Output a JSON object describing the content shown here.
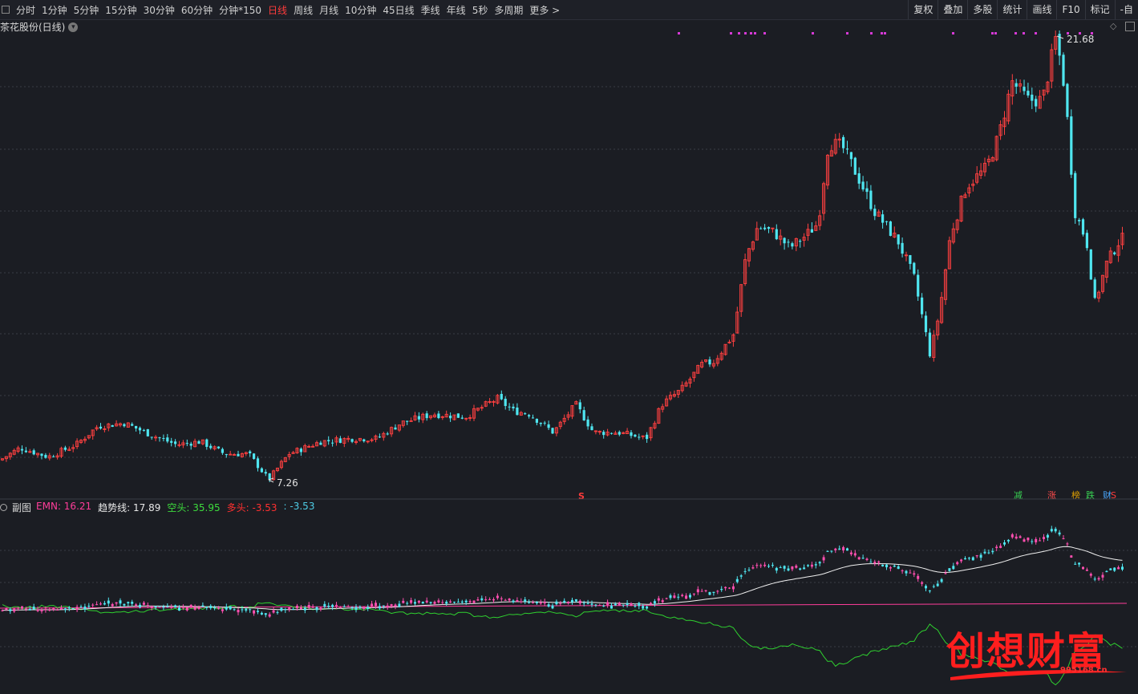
{
  "toolbar": {
    "periods": [
      "分时",
      "1分钟",
      "5分钟",
      "15分钟",
      "30分钟",
      "60分钟",
      "分钟*150",
      "日线",
      "周线",
      "月线",
      "10分钟",
      "45日线",
      "季线",
      "年线",
      "5秒",
      "多周期",
      "更多 >"
    ],
    "active_period": "日线",
    "right_tools": [
      "复权",
      "叠加",
      "多股",
      "统计",
      "画线",
      "F10",
      "标记",
      "-自"
    ]
  },
  "chart": {
    "title": "茶花股份(日线)",
    "high_label": "21.68",
    "low_label": "7.26",
    "signal_labels": [
      {
        "text": "减",
        "color": "#39d353"
      },
      {
        "text": "涨",
        "color": "#ff4b4b"
      },
      {
        "text": "榜",
        "color": "#e0a000"
      },
      {
        "text": "跌",
        "color": "#39d353"
      },
      {
        "text": "财",
        "color": "#4aa8ff"
      },
      {
        "text": "S",
        "color": "#ff3b3b"
      }
    ],
    "s_marker": "S"
  },
  "sub": {
    "name": "副图",
    "items": [
      {
        "label": "EMN",
        "value": "16.21",
        "label_color": "#ff3d9a",
        "value_color": "#ff3d9a"
      },
      {
        "label": "趋势线",
        "value": "17.89",
        "label_color": "#e8e8e8",
        "value_color": "#e8e8e8"
      },
      {
        "label": "空头",
        "value": "35.95",
        "label_color": "#3ddc3d",
        "value_color": "#3ddc3d"
      },
      {
        "label": "多头",
        "value": "-3.53",
        "label_color": "#ff3030",
        "value_color": "#ff3030"
      },
      {
        "label": "",
        "value": "-3.53",
        "label_color": "#4ecde6",
        "value_color": "#4ecde6"
      }
    ]
  },
  "watermark": {
    "text": "创想财富",
    "url": "995168.cn"
  },
  "chart_data": {
    "type": "candlestick",
    "y_max": 21.68,
    "y_min": 7.26,
    "control_points": [
      [
        0,
        7.9
      ],
      [
        25,
        8.3
      ],
      [
        60,
        8.0
      ],
      [
        95,
        8.4
      ],
      [
        122,
        9.0
      ],
      [
        155,
        9.1
      ],
      [
        190,
        8.7
      ],
      [
        220,
        8.4
      ],
      [
        250,
        8.5
      ],
      [
        280,
        8.1
      ],
      [
        310,
        8.1
      ],
      [
        335,
        7.26
      ],
      [
        360,
        8.1
      ],
      [
        400,
        8.5
      ],
      [
        440,
        8.6
      ],
      [
        470,
        8.6
      ],
      [
        500,
        9.1
      ],
      [
        540,
        9.4
      ],
      [
        580,
        9.3
      ],
      [
        620,
        9.9
      ],
      [
        640,
        9.5
      ],
      [
        660,
        9.4
      ],
      [
        690,
        8.8
      ],
      [
        718,
        9.7
      ],
      [
        740,
        8.8
      ],
      [
        770,
        8.8
      ],
      [
        806,
        8.6
      ],
      [
        825,
        9.7
      ],
      [
        850,
        10.2
      ],
      [
        875,
        11.0
      ],
      [
        890,
        11.1
      ],
      [
        915,
        12.0
      ],
      [
        930,
        14.5
      ],
      [
        945,
        15.5
      ],
      [
        965,
        15.3
      ],
      [
        985,
        14.8
      ],
      [
        1005,
        15.2
      ],
      [
        1020,
        15.6
      ],
      [
        1033,
        18.2
      ],
      [
        1050,
        18.1
      ],
      [
        1068,
        17.2
      ],
      [
        1090,
        16.0
      ],
      [
        1120,
        15.0
      ],
      [
        1140,
        13.8
      ],
      [
        1160,
        11.3
      ],
      [
        1172,
        12.8
      ],
      [
        1185,
        15.2
      ],
      [
        1205,
        16.8
      ],
      [
        1230,
        17.4
      ],
      [
        1245,
        18.4
      ],
      [
        1262,
        20.2
      ],
      [
        1282,
        19.6
      ],
      [
        1300,
        19.6
      ],
      [
        1317,
        21.68
      ],
      [
        1328,
        19.9
      ],
      [
        1340,
        16.0
      ],
      [
        1355,
        15.0
      ],
      [
        1365,
        13.0
      ],
      [
        1380,
        14.3
      ],
      [
        1395,
        15.0
      ],
      [
        1405,
        15.2
      ]
    ],
    "sub_lines": [
      "EMN",
      "趋势线",
      "空头",
      "多头"
    ]
  }
}
